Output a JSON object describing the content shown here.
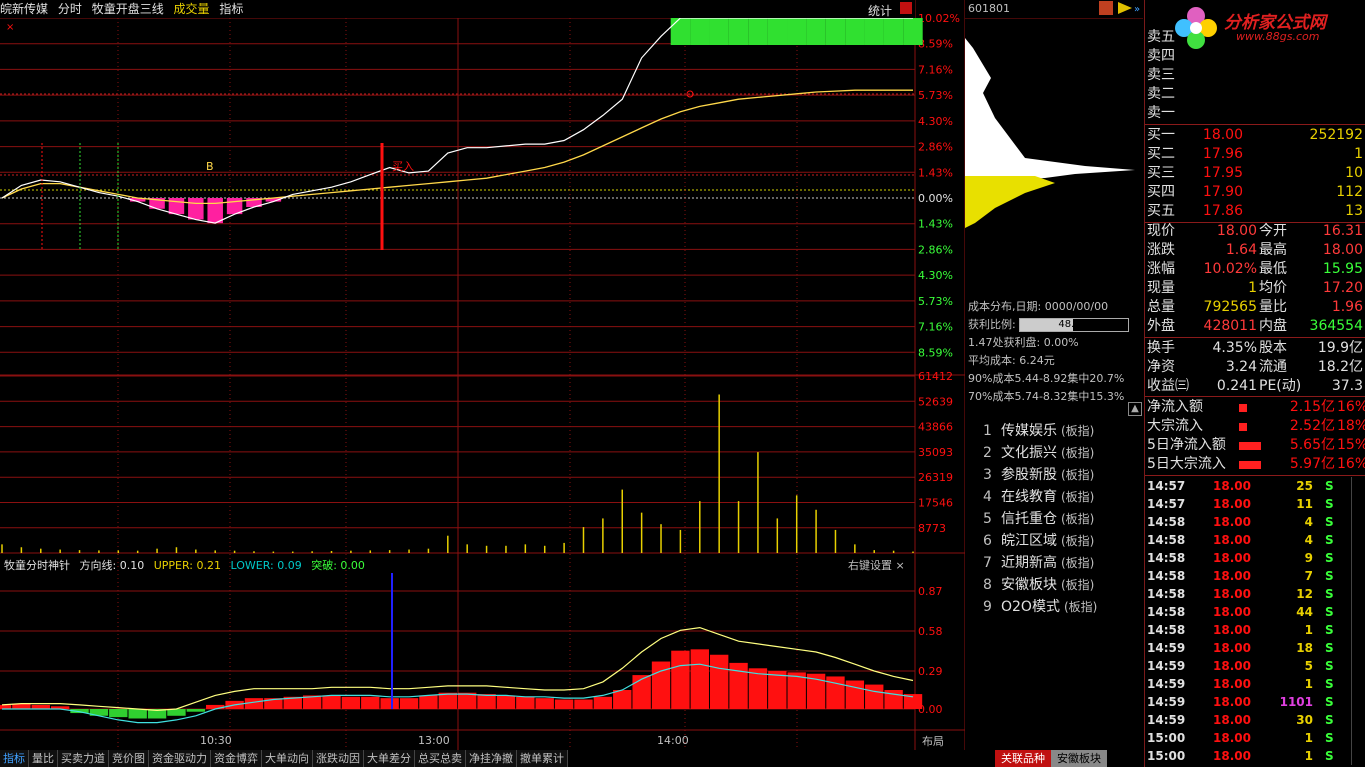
{
  "header": {
    "stock_name": "皖新传媒",
    "mode": "分时",
    "indicator_name": "牧童开盘三线",
    "volume_label": "成交量",
    "index_label": "指标",
    "stats_label": "统计"
  },
  "price_axis_labels": [
    "10.02%",
    "8.59%",
    "7.16%",
    "5.73%",
    "4.30%",
    "2.86%",
    "1.43%",
    "0.00%",
    "1.43%",
    "2.86%",
    "4.30%",
    "5.73%",
    "7.16%",
    "8.59%"
  ],
  "volume_axis_labels": [
    "61412",
    "52639",
    "43866",
    "35093",
    "26319",
    "17546",
    "8773"
  ],
  "indicator_axis_labels": [
    "0.87",
    "0.58",
    "0.29",
    "0.00"
  ],
  "time_axis_labels": [
    "10:30",
    "13:00",
    "14:00"
  ],
  "chart_marks": {
    "b_label": "B",
    "buy_label": "买入"
  },
  "indicator": {
    "name": "牧童分时神针",
    "direction": "方向线: 0.10",
    "upper": "UPPER: 0.21",
    "lower": "LOWER: 0.09",
    "breakthrough": "突破: 0.00",
    "settings": "右键设置"
  },
  "bottom_tabs": [
    "指标",
    "量比",
    "买卖力道",
    "竞价图",
    "资金驱动力",
    "资金博弈",
    "大单动向",
    "涨跌动因",
    "大单差分",
    "总买总卖",
    "净挂净撤",
    "撤单累计"
  ],
  "layout_label": "布局",
  "related_tabs": [
    "关联品种",
    "安徽板块"
  ],
  "middle": {
    "code": "601801",
    "cost_title": "成本分布,日期: 0000/00/00",
    "profit_ratio_label": "获利比例:",
    "profit_ratio": "48.7%",
    "profit_ratio_value": 48.7,
    "profit_at": "1.47处获利盘: 0.00%",
    "avg_cost": "平均成本: 6.24元",
    "cost90": "90%成本5.44-8.92集中20.7%",
    "cost70": "70%成本5.74-8.32集中15.3%"
  },
  "blocks": [
    {
      "n": "1",
      "name": "传媒娱乐",
      "tag": "(板指)"
    },
    {
      "n": "2",
      "name": "文化振兴",
      "tag": "(板指)"
    },
    {
      "n": "3",
      "name": "参股新股",
      "tag": "(板指)"
    },
    {
      "n": "4",
      "name": "在线教育",
      "tag": "(板指)"
    },
    {
      "n": "5",
      "name": "信托重仓",
      "tag": "(板指)"
    },
    {
      "n": "6",
      "name": "皖江区域",
      "tag": "(板指)"
    },
    {
      "n": "7",
      "name": "近期新高",
      "tag": "(板指)"
    },
    {
      "n": "8",
      "name": "安徽板块",
      "tag": "(板指)"
    },
    {
      "n": "9",
      "name": "O2O模式",
      "tag": "(板指)"
    }
  ],
  "logo": {
    "text": "分析家公式网",
    "url": "www.88gs.com"
  },
  "sell_levels": [
    "卖五",
    "卖四",
    "卖三",
    "卖二",
    "卖一"
  ],
  "buy_levels": [
    {
      "label": "买一",
      "price": "18.00",
      "vol": "252192"
    },
    {
      "label": "买二",
      "price": "17.96",
      "vol": "1"
    },
    {
      "label": "买三",
      "price": "17.95",
      "vol": "10"
    },
    {
      "label": "买四",
      "price": "17.90",
      "vol": "112"
    },
    {
      "label": "买五",
      "price": "17.86",
      "vol": "13"
    }
  ],
  "quote": [
    {
      "l1": "现价",
      "v1": "18.00",
      "c1": "#ff3a3a",
      "l2": "今开",
      "v2": "16.31",
      "c2": "#ff3a3a"
    },
    {
      "l1": "涨跌",
      "v1": "1.64",
      "c1": "#ff3a3a",
      "l2": "最高",
      "v2": "18.00",
      "c2": "#ff3a3a"
    },
    {
      "l1": "涨幅",
      "v1": "10.02%",
      "c1": "#ff3a3a",
      "l2": "最低",
      "v2": "15.95",
      "c2": "#3aff3a"
    },
    {
      "l1": "现量",
      "v1": "1",
      "c1": "#e8d000",
      "l2": "均价",
      "v2": "17.20",
      "c2": "#ff3a3a"
    },
    {
      "l1": "总量",
      "v1": "792565",
      "c1": "#e8d000",
      "l2": "量比",
      "v2": "1.96",
      "c2": "#ff3a3a"
    },
    {
      "l1": "外盘",
      "v1": "428011",
      "c1": "#ff3a3a",
      "l2": "内盘",
      "v2": "364554",
      "c2": "#3aff3a"
    }
  ],
  "fund": [
    {
      "l1": "换手",
      "v1": "4.35%",
      "l2": "股本",
      "v2": "19.9亿"
    },
    {
      "l1": "净资",
      "v1": "3.24",
      "l2": "流通",
      "v2": "18.2亿"
    },
    {
      "l1": "收益㈢",
      "v1": "0.241",
      "l2": "PE(动)",
      "v2": "37.3"
    }
  ],
  "flow": [
    {
      "label": "净流入额",
      "val": "2.15亿",
      "pct": "16%"
    },
    {
      "label": "大宗流入",
      "val": "2.52亿",
      "pct": "18%"
    },
    {
      "label": "5日净流入额",
      "val": "5.65亿",
      "pct": "15%"
    },
    {
      "label": "5日大宗流入",
      "val": "5.97亿",
      "pct": "16%"
    }
  ],
  "ticks": [
    {
      "t": "14:57",
      "p": "18.00",
      "v": "25",
      "s": "S",
      "vc": "#e8d000"
    },
    {
      "t": "14:57",
      "p": "18.00",
      "v": "11",
      "s": "S",
      "vc": "#e8d000"
    },
    {
      "t": "14:58",
      "p": "18.00",
      "v": "4",
      "s": "S",
      "vc": "#e8d000"
    },
    {
      "t": "14:58",
      "p": "18.00",
      "v": "4",
      "s": "S",
      "vc": "#e8d000"
    },
    {
      "t": "14:58",
      "p": "18.00",
      "v": "9",
      "s": "S",
      "vc": "#e8d000"
    },
    {
      "t": "14:58",
      "p": "18.00",
      "v": "7",
      "s": "S",
      "vc": "#e8d000"
    },
    {
      "t": "14:58",
      "p": "18.00",
      "v": "12",
      "s": "S",
      "vc": "#e8d000"
    },
    {
      "t": "14:58",
      "p": "18.00",
      "v": "44",
      "s": "S",
      "vc": "#e8d000"
    },
    {
      "t": "14:58",
      "p": "18.00",
      "v": "1",
      "s": "S",
      "vc": "#e8d000"
    },
    {
      "t": "14:59",
      "p": "18.00",
      "v": "18",
      "s": "S",
      "vc": "#e8d000"
    },
    {
      "t": "14:59",
      "p": "18.00",
      "v": "5",
      "s": "S",
      "vc": "#e8d000"
    },
    {
      "t": "14:59",
      "p": "18.00",
      "v": "1",
      "s": "S",
      "vc": "#e8d000"
    },
    {
      "t": "14:59",
      "p": "18.00",
      "v": "1101",
      "s": "S",
      "vc": "#e040e0"
    },
    {
      "t": "14:59",
      "p": "18.00",
      "v": "30",
      "s": "S",
      "vc": "#e8d000"
    },
    {
      "t": "15:00",
      "p": "18.00",
      "v": "1",
      "s": "S",
      "vc": "#e8d000"
    },
    {
      "t": "15:00",
      "p": "18.00",
      "v": "1",
      "s": "S",
      "vc": "#e8d000"
    }
  ],
  "chart_data": {
    "type": "line",
    "title": "",
    "price_pct_range": [
      -10.02,
      10.02
    ],
    "price_line": [
      0,
      0.7,
      1.0,
      0.9,
      0.6,
      0.3,
      0.1,
      -0.2,
      -0.6,
      -0.9,
      -1.2,
      -1.4,
      -0.9,
      -0.5,
      -0.2,
      0.2,
      0.4,
      0.6,
      0.9,
      1.3,
      1.7,
      1.4,
      1.5,
      2.5,
      2.8,
      2.8,
      2.9,
      3.0,
      3.0,
      3.2,
      3.8,
      4.6,
      5.5,
      7.8,
      9.0,
      10.02,
      10.02,
      10.02,
      10.02,
      10.02,
      10.02,
      10.02,
      10.02,
      10.02,
      10.02,
      10.02,
      10.02,
      10.02
    ],
    "avg_line": [
      0,
      0.5,
      0.8,
      0.8,
      0.6,
      0.4,
      0.2,
      0.0,
      -0.1,
      -0.2,
      -0.3,
      -0.3,
      -0.2,
      -0.1,
      0.0,
      0.1,
      0.2,
      0.3,
      0.4,
      0.5,
      0.6,
      0.7,
      0.8,
      0.9,
      1.0,
      1.1,
      1.3,
      1.5,
      1.7,
      2.0,
      2.4,
      2.9,
      3.4,
      3.9,
      4.4,
      4.8,
      5.1,
      5.3,
      5.5,
      5.6,
      5.7,
      5.8,
      5.9,
      5.95,
      6.0,
      6.0,
      6.0,
      6.0
    ],
    "volume": [
      3000,
      2000,
      1500,
      1200,
      1000,
      900,
      900,
      800,
      1500,
      2000,
      1200,
      900,
      800,
      600,
      500,
      500,
      600,
      700,
      800,
      900,
      1000,
      1200,
      1500,
      6000,
      3000,
      2500,
      2500,
      3000,
      2500,
      3500,
      9000,
      12000,
      22000,
      14000,
      10000,
      8000,
      18000,
      55000,
      18000,
      35000,
      12000,
      20000,
      15000,
      8000,
      3000,
      1000,
      800,
      500
    ],
    "volume_range": [
      0,
      61412
    ],
    "indicator_range": [
      -0.1,
      0.87
    ],
    "indicator_bars": [
      0.03,
      0.04,
      0.03,
      0.02,
      -0.03,
      -0.05,
      -0.06,
      -0.07,
      -0.07,
      -0.05,
      -0.02,
      0.03,
      0.06,
      0.08,
      0.08,
      0.09,
      0.1,
      0.1,
      0.09,
      0.09,
      0.08,
      0.08,
      0.1,
      0.12,
      0.12,
      0.11,
      0.1,
      0.09,
      0.08,
      0.07,
      0.07,
      0.09,
      0.14,
      0.25,
      0.35,
      0.43,
      0.44,
      0.4,
      0.34,
      0.3,
      0.28,
      0.27,
      0.26,
      0.24,
      0.21,
      0.18,
      0.14,
      0.11
    ],
    "upper_line": [
      0.03,
      0.04,
      0.04,
      0.04,
      0.03,
      0.02,
      0.01,
      0.0,
      -0.01,
      0.0,
      0.05,
      0.1,
      0.13,
      0.15,
      0.15,
      0.15,
      0.15,
      0.16,
      0.16,
      0.16,
      0.15,
      0.15,
      0.16,
      0.17,
      0.17,
      0.17,
      0.16,
      0.15,
      0.14,
      0.14,
      0.15,
      0.2,
      0.3,
      0.42,
      0.52,
      0.58,
      0.6,
      0.55,
      0.5,
      0.48,
      0.46,
      0.44,
      0.42,
      0.38,
      0.33,
      0.28,
      0.24,
      0.21
    ],
    "lower_line": [
      0.0,
      0.0,
      0.0,
      0.0,
      -0.02,
      -0.05,
      -0.08,
      -0.1,
      -0.1,
      -0.08,
      -0.05,
      0.0,
      0.03,
      0.05,
      0.07,
      0.08,
      0.09,
      0.1,
      0.1,
      0.1,
      0.09,
      0.09,
      0.1,
      0.11,
      0.11,
      0.1,
      0.1,
      0.09,
      0.09,
      0.08,
      0.08,
      0.1,
      0.14,
      0.22,
      0.28,
      0.32,
      0.33,
      0.3,
      0.28,
      0.26,
      0.25,
      0.24,
      0.22,
      0.19,
      0.16,
      0.13,
      0.11,
      0.09
    ],
    "colors": {
      "up": "#ff1010",
      "down": "#00c800",
      "price": "#ffffff",
      "avg": "#ffd84a",
      "upper": "#ffff80",
      "lower": "#40e0e0",
      "grid": "#8a1010"
    }
  }
}
